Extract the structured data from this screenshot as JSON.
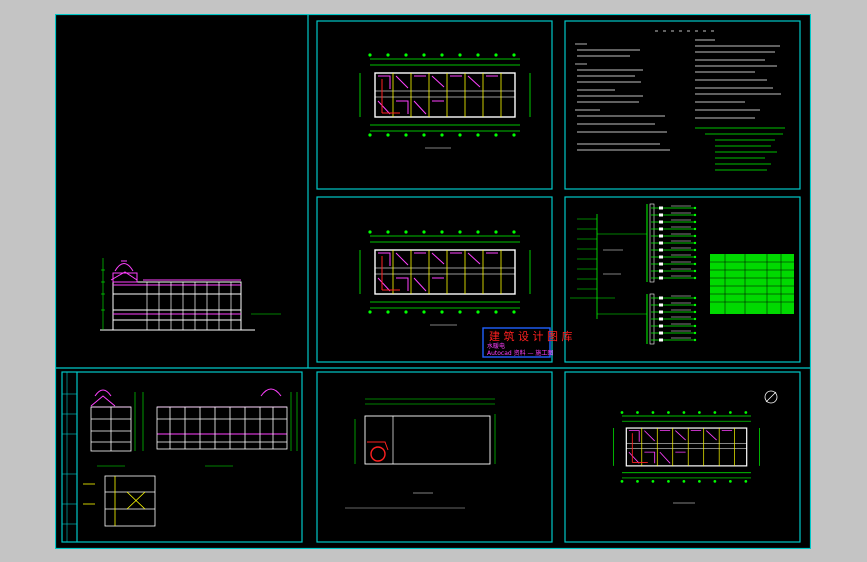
{
  "viewer": {
    "background": "#c4c4c4",
    "canvas_color": "#000000"
  },
  "drawing": {
    "frame_color": "#00c8c8",
    "line_colors": {
      "walls": "#ffffff",
      "dimensions": "#00ff00",
      "rooms": "#ffff00",
      "highlight": "#ff40ff",
      "red": "#ff2020",
      "cyan": "#00c8c8"
    },
    "stamp": {
      "title": "建 筑 设 计 图 库",
      "line1": "水暖电",
      "line2": "Autocad 资料 — 施工图"
    }
  }
}
